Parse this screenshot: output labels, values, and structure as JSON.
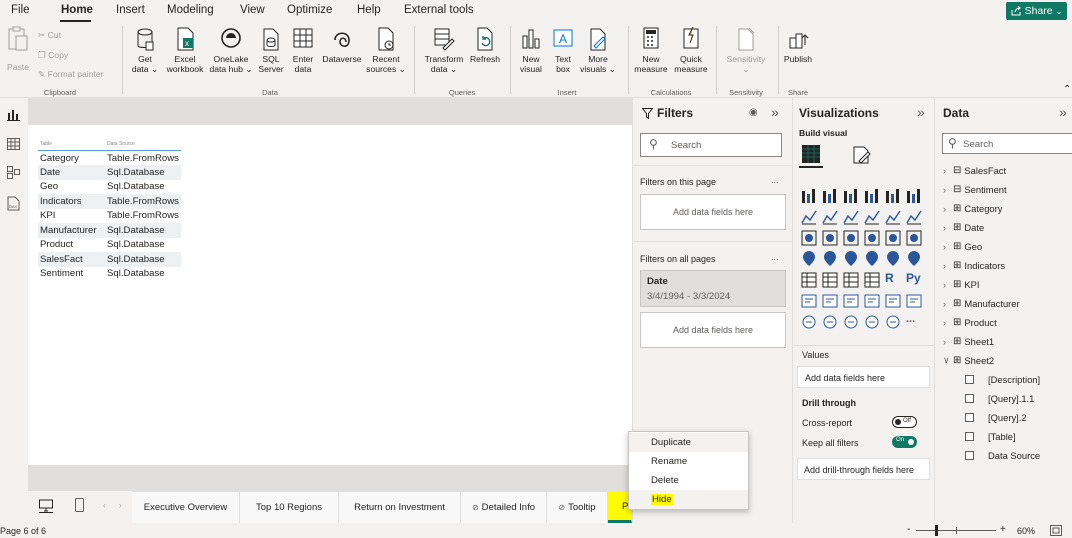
{
  "menu": {
    "tabs": [
      "File",
      "Home",
      "Insert",
      "Modeling",
      "View",
      "Optimize",
      "Help",
      "External tools"
    ],
    "active": "Home",
    "share_label": "Share"
  },
  "ribbon": {
    "clipboard": {
      "paste": "Paste",
      "cut": "Cut",
      "copy": "Copy",
      "format_painter": "Format painter",
      "group": "Clipboard"
    },
    "data": {
      "get_data": [
        "Get",
        "data ⌄"
      ],
      "excel": [
        "Excel",
        "workbook"
      ],
      "onelake": [
        "OneLake",
        "data hub ⌄"
      ],
      "sql": [
        "SQL",
        "Server"
      ],
      "enter": [
        "Enter",
        "data"
      ],
      "dataverse": [
        "Dataverse",
        ""
      ],
      "recent": [
        "Recent",
        "sources ⌄"
      ],
      "group": "Data"
    },
    "queries": {
      "transform": [
        "Transform",
        "data ⌄"
      ],
      "refresh": [
        "Refresh",
        ""
      ],
      "group": "Queries"
    },
    "insert": {
      "new_visual": [
        "New",
        "visual"
      ],
      "text_box": [
        "Text",
        "box"
      ],
      "more_visuals": [
        "More",
        "visuals ⌄"
      ],
      "group": "Insert"
    },
    "calculations": {
      "new_measure": [
        "New",
        "measure"
      ],
      "quick_measure": [
        "Quick",
        "measure"
      ],
      "group": "Calculations"
    },
    "sensitivity": {
      "label": [
        "Sensitivity",
        "⌄"
      ],
      "group": "Sensitivity"
    },
    "share": {
      "publish": "Publish",
      "group": "Share"
    }
  },
  "table": {
    "headers": [
      "Table",
      "Data Source"
    ],
    "rows": [
      [
        "Category",
        "Table.FromRows"
      ],
      [
        "Date",
        "Sql.Database"
      ],
      [
        "Geo",
        "Sql.Database"
      ],
      [
        "Indicators",
        "Table.FromRows"
      ],
      [
        "KPI",
        "Table.FromRows"
      ],
      [
        "Manufacturer",
        "Sql.Database"
      ],
      [
        "Product",
        "Sql.Database"
      ],
      [
        "SalesFact",
        "Sql.Database"
      ],
      [
        "Sentiment",
        "Sql.Database"
      ]
    ]
  },
  "page_tabs": [
    "Executive Overview",
    "Top 10 Regions",
    "Return on Investment",
    "Detailed Info",
    "Tooltip",
    "Pag"
  ],
  "status": {
    "page": "Page 6 of 6",
    "zoom": "60%",
    "zoom_minus": "-",
    "zoom_plus": "+"
  },
  "filters": {
    "title": "Filters",
    "search_placeholder": "Search",
    "on_this_page": "Filters on this page",
    "on_all_pages": "Filters on all pages",
    "add_fields": "Add data fields here",
    "date_card": {
      "name": "Date",
      "range": "3/4/1994 - 3/3/2024"
    },
    "more": "..."
  },
  "visualizations": {
    "title": "Visualizations",
    "build_visual": "Build visual",
    "values": "Values",
    "add_fields": "Add data fields here",
    "drill_through": "Drill through",
    "cross_report": "Cross-report",
    "cross_report_state": "Off",
    "keep_all_filters": "Keep all filters",
    "keep_all_filters_state": "On",
    "add_drill": "Add drill-through fields here",
    "r_label": "R",
    "py_label": "Py",
    "more": "..."
  },
  "data_pane": {
    "title": "Data",
    "search_placeholder": "Search",
    "tables": [
      "SalesFact",
      "Sentiment",
      "Category",
      "Date",
      "Geo",
      "Indicators",
      "KPI",
      "Manufacturer",
      "Product",
      "Sheet1",
      "Sheet2"
    ],
    "sheet2_fields": [
      "[Description]",
      "[Query].1.1",
      "[Query].2",
      "[Table]",
      "Data Source"
    ]
  },
  "context_menu": {
    "items": [
      "Duplicate",
      "Rename",
      "Delete",
      "Hide"
    ],
    "highlighted": "Hide"
  },
  "colors": {
    "accent": "#117865",
    "highlight": "#fffc00",
    "toggle": "#117865"
  }
}
